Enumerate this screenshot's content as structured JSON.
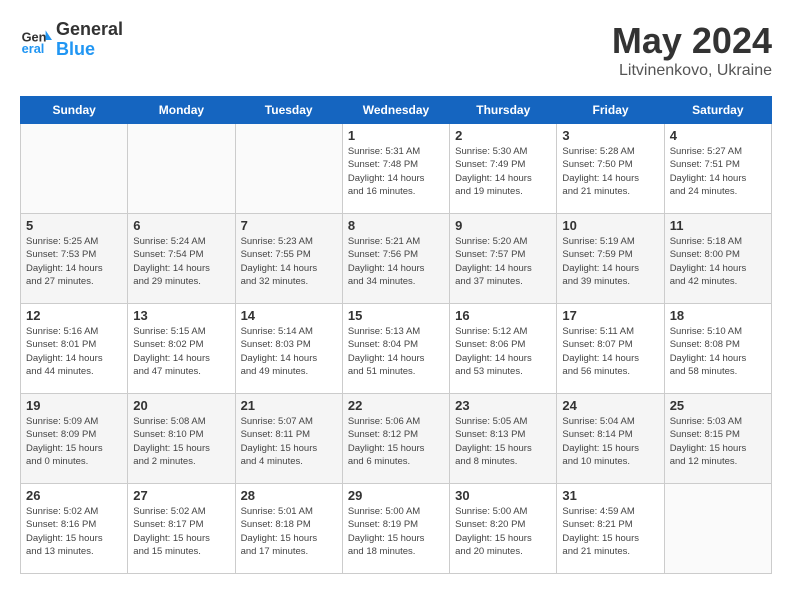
{
  "header": {
    "logo_line1": "General",
    "logo_line2": "Blue",
    "month_year": "May 2024",
    "location": "Litvinenkovo, Ukraine"
  },
  "weekdays": [
    "Sunday",
    "Monday",
    "Tuesday",
    "Wednesday",
    "Thursday",
    "Friday",
    "Saturday"
  ],
  "weeks": [
    [
      {
        "day": "",
        "info": ""
      },
      {
        "day": "",
        "info": ""
      },
      {
        "day": "",
        "info": ""
      },
      {
        "day": "1",
        "info": "Sunrise: 5:31 AM\nSunset: 7:48 PM\nDaylight: 14 hours\nand 16 minutes."
      },
      {
        "day": "2",
        "info": "Sunrise: 5:30 AM\nSunset: 7:49 PM\nDaylight: 14 hours\nand 19 minutes."
      },
      {
        "day": "3",
        "info": "Sunrise: 5:28 AM\nSunset: 7:50 PM\nDaylight: 14 hours\nand 21 minutes."
      },
      {
        "day": "4",
        "info": "Sunrise: 5:27 AM\nSunset: 7:51 PM\nDaylight: 14 hours\nand 24 minutes."
      }
    ],
    [
      {
        "day": "5",
        "info": "Sunrise: 5:25 AM\nSunset: 7:53 PM\nDaylight: 14 hours\nand 27 minutes."
      },
      {
        "day": "6",
        "info": "Sunrise: 5:24 AM\nSunset: 7:54 PM\nDaylight: 14 hours\nand 29 minutes."
      },
      {
        "day": "7",
        "info": "Sunrise: 5:23 AM\nSunset: 7:55 PM\nDaylight: 14 hours\nand 32 minutes."
      },
      {
        "day": "8",
        "info": "Sunrise: 5:21 AM\nSunset: 7:56 PM\nDaylight: 14 hours\nand 34 minutes."
      },
      {
        "day": "9",
        "info": "Sunrise: 5:20 AM\nSunset: 7:57 PM\nDaylight: 14 hours\nand 37 minutes."
      },
      {
        "day": "10",
        "info": "Sunrise: 5:19 AM\nSunset: 7:59 PM\nDaylight: 14 hours\nand 39 minutes."
      },
      {
        "day": "11",
        "info": "Sunrise: 5:18 AM\nSunset: 8:00 PM\nDaylight: 14 hours\nand 42 minutes."
      }
    ],
    [
      {
        "day": "12",
        "info": "Sunrise: 5:16 AM\nSunset: 8:01 PM\nDaylight: 14 hours\nand 44 minutes."
      },
      {
        "day": "13",
        "info": "Sunrise: 5:15 AM\nSunset: 8:02 PM\nDaylight: 14 hours\nand 47 minutes."
      },
      {
        "day": "14",
        "info": "Sunrise: 5:14 AM\nSunset: 8:03 PM\nDaylight: 14 hours\nand 49 minutes."
      },
      {
        "day": "15",
        "info": "Sunrise: 5:13 AM\nSunset: 8:04 PM\nDaylight: 14 hours\nand 51 minutes."
      },
      {
        "day": "16",
        "info": "Sunrise: 5:12 AM\nSunset: 8:06 PM\nDaylight: 14 hours\nand 53 minutes."
      },
      {
        "day": "17",
        "info": "Sunrise: 5:11 AM\nSunset: 8:07 PM\nDaylight: 14 hours\nand 56 minutes."
      },
      {
        "day": "18",
        "info": "Sunrise: 5:10 AM\nSunset: 8:08 PM\nDaylight: 14 hours\nand 58 minutes."
      }
    ],
    [
      {
        "day": "19",
        "info": "Sunrise: 5:09 AM\nSunset: 8:09 PM\nDaylight: 15 hours\nand 0 minutes."
      },
      {
        "day": "20",
        "info": "Sunrise: 5:08 AM\nSunset: 8:10 PM\nDaylight: 15 hours\nand 2 minutes."
      },
      {
        "day": "21",
        "info": "Sunrise: 5:07 AM\nSunset: 8:11 PM\nDaylight: 15 hours\nand 4 minutes."
      },
      {
        "day": "22",
        "info": "Sunrise: 5:06 AM\nSunset: 8:12 PM\nDaylight: 15 hours\nand 6 minutes."
      },
      {
        "day": "23",
        "info": "Sunrise: 5:05 AM\nSunset: 8:13 PM\nDaylight: 15 hours\nand 8 minutes."
      },
      {
        "day": "24",
        "info": "Sunrise: 5:04 AM\nSunset: 8:14 PM\nDaylight: 15 hours\nand 10 minutes."
      },
      {
        "day": "25",
        "info": "Sunrise: 5:03 AM\nSunset: 8:15 PM\nDaylight: 15 hours\nand 12 minutes."
      }
    ],
    [
      {
        "day": "26",
        "info": "Sunrise: 5:02 AM\nSunset: 8:16 PM\nDaylight: 15 hours\nand 13 minutes."
      },
      {
        "day": "27",
        "info": "Sunrise: 5:02 AM\nSunset: 8:17 PM\nDaylight: 15 hours\nand 15 minutes."
      },
      {
        "day": "28",
        "info": "Sunrise: 5:01 AM\nSunset: 8:18 PM\nDaylight: 15 hours\nand 17 minutes."
      },
      {
        "day": "29",
        "info": "Sunrise: 5:00 AM\nSunset: 8:19 PM\nDaylight: 15 hours\nand 18 minutes."
      },
      {
        "day": "30",
        "info": "Sunrise: 5:00 AM\nSunset: 8:20 PM\nDaylight: 15 hours\nand 20 minutes."
      },
      {
        "day": "31",
        "info": "Sunrise: 4:59 AM\nSunset: 8:21 PM\nDaylight: 15 hours\nand 21 minutes."
      },
      {
        "day": "",
        "info": ""
      }
    ]
  ]
}
